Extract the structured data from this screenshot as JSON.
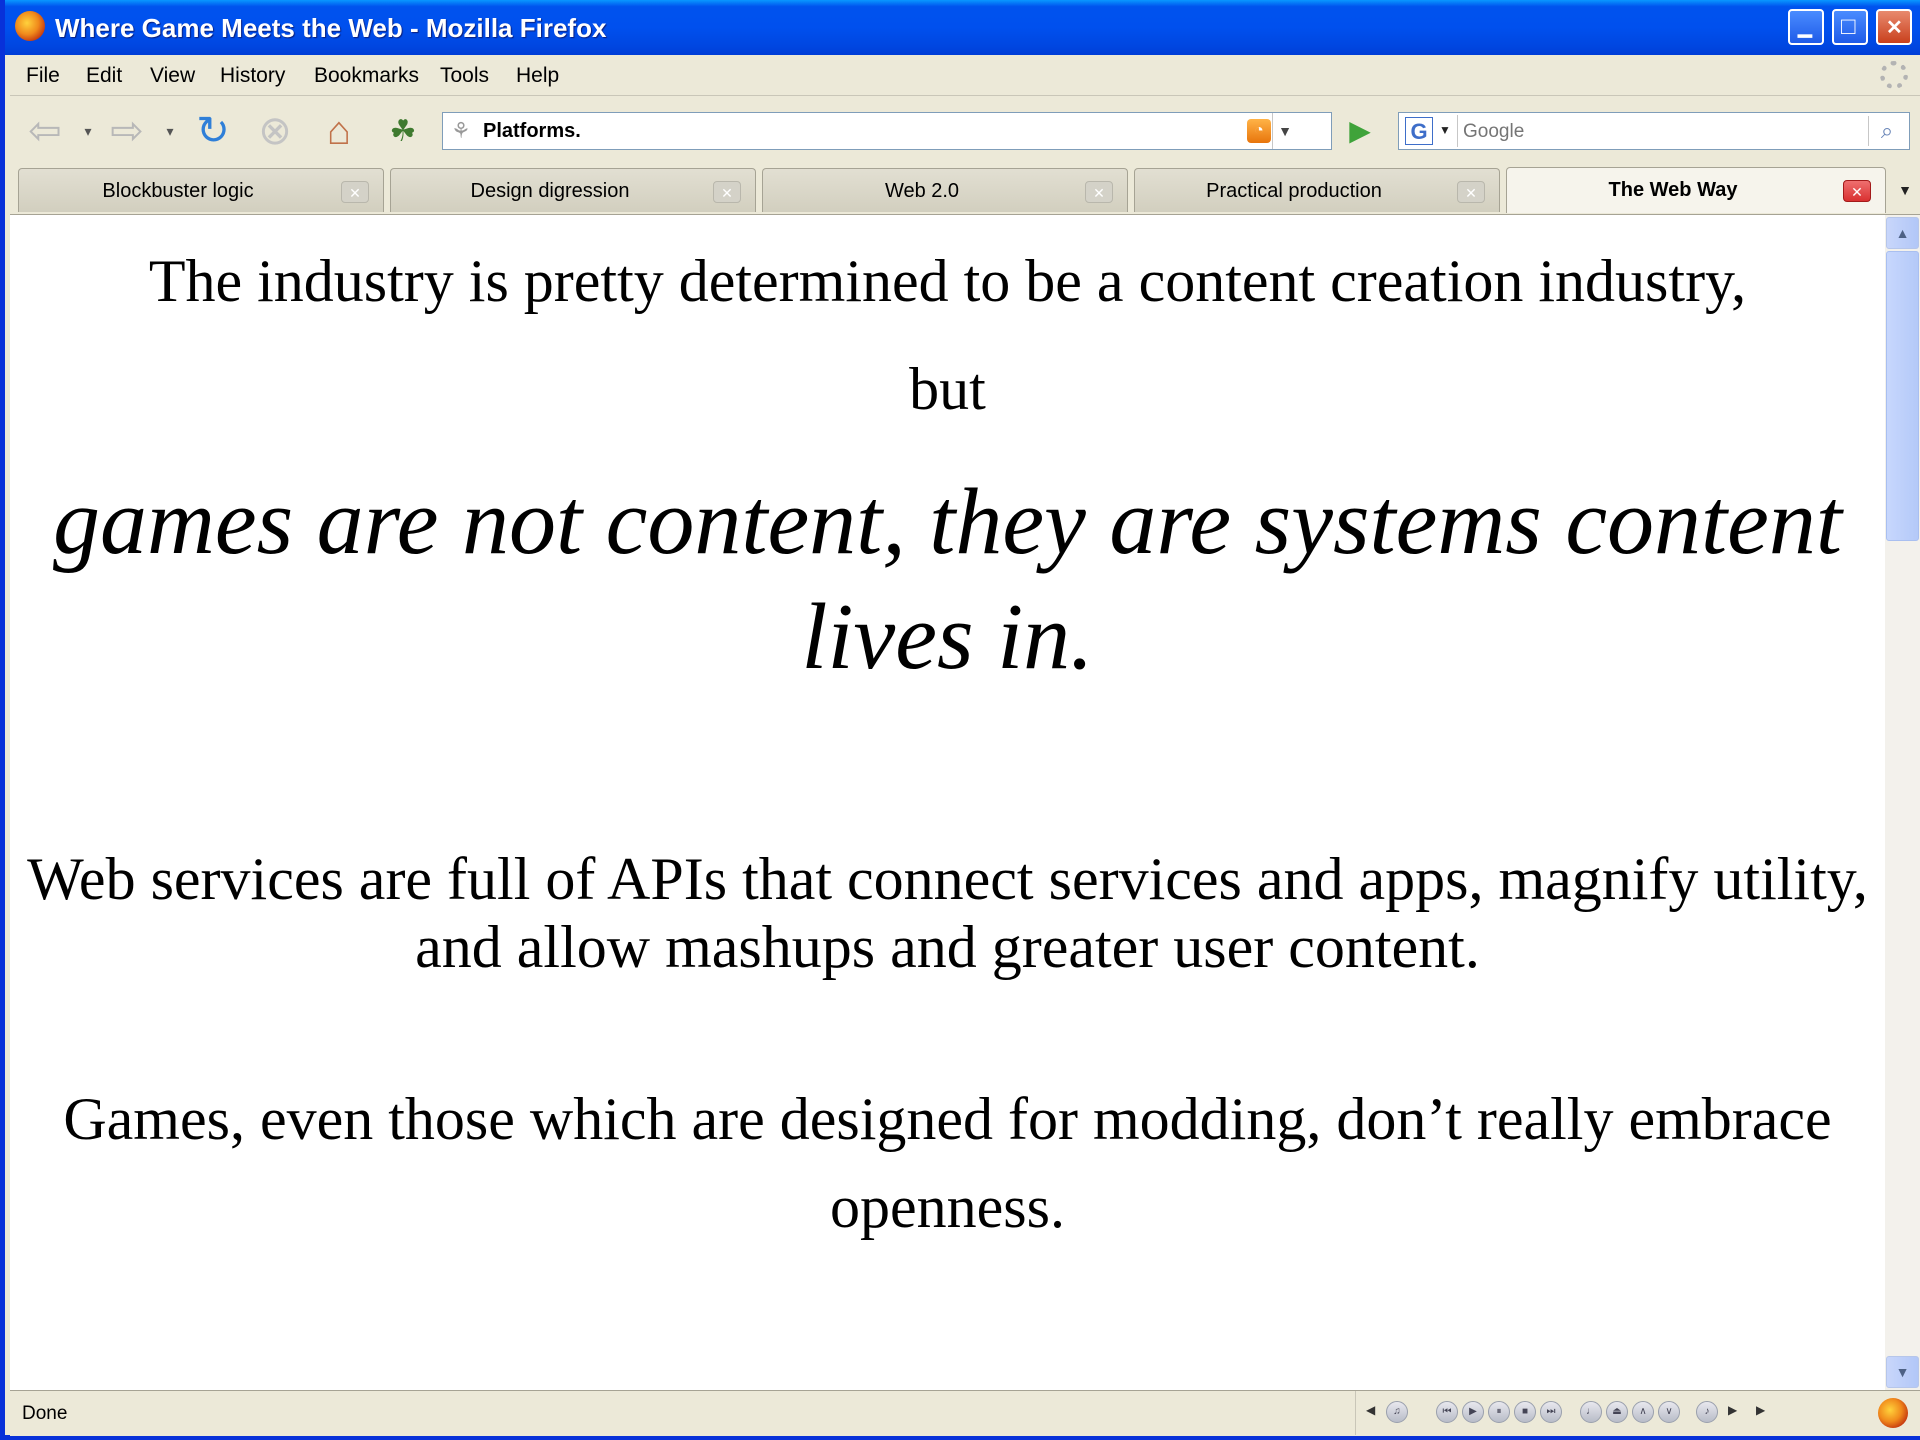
{
  "window": {
    "title": "Where Game Meets the Web - Mozilla Firefox",
    "buttons": {
      "minimize": "▁",
      "maximize": "□",
      "close": "✕"
    }
  },
  "menubar": {
    "items": [
      "File",
      "Edit",
      "View",
      "History",
      "Bookmarks",
      "Tools",
      "Help"
    ]
  },
  "navbar": {
    "url": "Platforms.",
    "search": {
      "engine_label": "G",
      "placeholder": "Google"
    }
  },
  "tabs": [
    {
      "label": "Blockbuster logic",
      "active": false
    },
    {
      "label": "Design digression",
      "active": false
    },
    {
      "label": "Web 2.0",
      "active": false
    },
    {
      "label": "Practical production",
      "active": false
    },
    {
      "label": "The Web Way",
      "active": true
    }
  ],
  "content": {
    "line1": "The industry is pretty determined to be a content creation industry,",
    "line2": "but",
    "emphasis": "games are not content, they are systems content lives in.",
    "paragraph2": "Web services are full of APIs that connect services and apps, magnify utility, and allow mashups and greater user content.",
    "paragraph3": "Games, even those which are designed for modding, don’t really embrace openness."
  },
  "statusbar": {
    "text": "Done"
  }
}
